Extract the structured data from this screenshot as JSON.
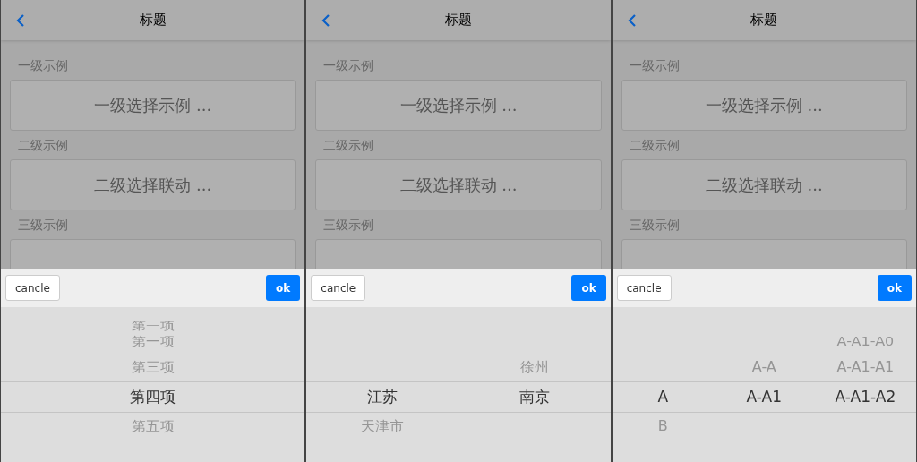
{
  "panels": [
    {
      "header": {
        "title": "标题"
      },
      "sections": [
        {
          "label": "一级示例",
          "button": "一级选择示例 ..."
        },
        {
          "label": "二级示例",
          "button": "二级选择联动 ..."
        },
        {
          "label": "三级示例"
        }
      ],
      "picker": {
        "cancel": "cancle",
        "ok": "ok",
        "columns": [
          {
            "items": [
              {
                "label": "第一项",
                "selected": false
              },
              {
                "label": "第一项",
                "selected": false
              },
              {
                "label": "第三项",
                "selected": false
              },
              {
                "label": "第四项",
                "selected": true
              },
              {
                "label": "第五项",
                "selected": false
              }
            ]
          }
        ]
      }
    },
    {
      "header": {
        "title": "标题"
      },
      "sections": [
        {
          "label": "一级示例",
          "button": "一级选择示例 ..."
        },
        {
          "label": "二级示例",
          "button": "二级选择联动 ..."
        },
        {
          "label": "三级示例"
        }
      ],
      "picker": {
        "cancel": "cancle",
        "ok": "ok",
        "columns": [
          {
            "items": [
              {
                "label": "江苏",
                "selected": true
              },
              {
                "label": "天津市",
                "selected": false
              }
            ]
          },
          {
            "items": [
              {
                "label": "徐州",
                "selected": false
              },
              {
                "label": "南京",
                "selected": true
              }
            ]
          }
        ]
      }
    },
    {
      "header": {
        "title": "标题"
      },
      "sections": [
        {
          "label": "一级示例",
          "button": "一级选择示例 ..."
        },
        {
          "label": "二级示例",
          "button": "二级选择联动 ..."
        },
        {
          "label": "三级示例"
        }
      ],
      "picker": {
        "cancel": "cancle",
        "ok": "ok",
        "columns": [
          {
            "items": [
              {
                "label": "A",
                "selected": true
              },
              {
                "label": "B",
                "selected": false
              }
            ]
          },
          {
            "items": [
              {
                "label": "A-A",
                "selected": false
              },
              {
                "label": "A-A1",
                "selected": true
              }
            ]
          },
          {
            "items": [
              {
                "label": "A-A1-A0",
                "selected": false
              },
              {
                "label": "A-A1-A1",
                "selected": false
              },
              {
                "label": "A-A1-A2",
                "selected": true
              }
            ]
          }
        ]
      }
    }
  ]
}
